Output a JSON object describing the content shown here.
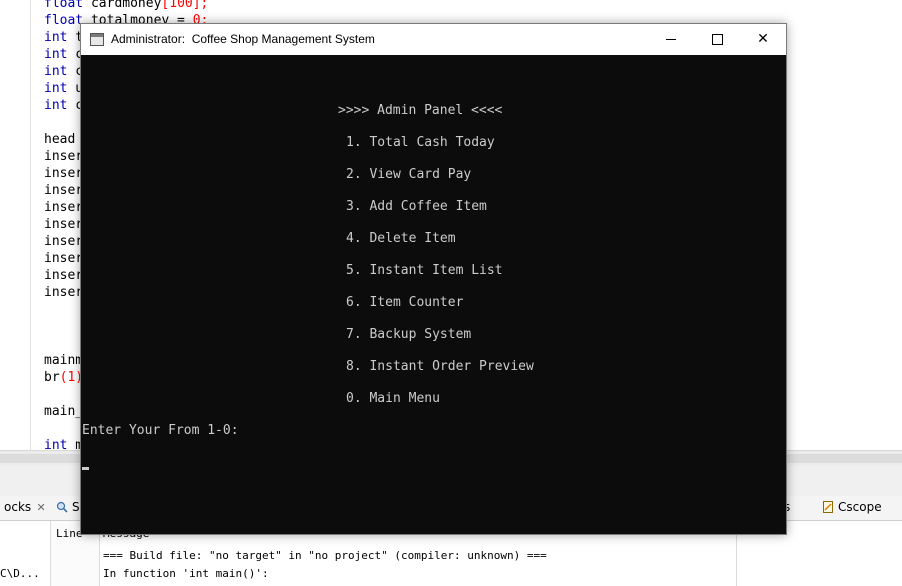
{
  "editor": {
    "lines": [
      {
        "kw": "float",
        "rest": " cardmoney",
        "num": "[100];"
      },
      {
        "kw": "float",
        "rest": " totalmoney = ",
        "num": "0;"
      },
      {
        "kw": "int",
        "rest": " t",
        "num": ""
      },
      {
        "kw": "int",
        "rest": " c",
        "num": ""
      },
      {
        "kw": "int",
        "rest": " c",
        "num": ""
      },
      {
        "kw": "int",
        "rest": " u",
        "num": ""
      },
      {
        "kw": "int",
        "rest": " c",
        "num": ""
      },
      {
        "kw": "",
        "rest": "",
        "num": ""
      },
      {
        "kw": "",
        "rest": "head",
        "num": ""
      },
      {
        "kw": "",
        "rest": "inser",
        "num": ""
      },
      {
        "kw": "",
        "rest": "inser",
        "num": ""
      },
      {
        "kw": "",
        "rest": "inser",
        "num": ""
      },
      {
        "kw": "",
        "rest": "inser",
        "num": ""
      },
      {
        "kw": "",
        "rest": "inser",
        "num": ""
      },
      {
        "kw": "",
        "rest": "inser",
        "num": ""
      },
      {
        "kw": "",
        "rest": "inser",
        "num": ""
      },
      {
        "kw": "",
        "rest": "inser",
        "num": ""
      },
      {
        "kw": "",
        "rest": "inser",
        "num": ""
      },
      {
        "kw": "",
        "rest": "",
        "num": ""
      },
      {
        "kw": "",
        "rest": "",
        "num": ""
      },
      {
        "kw": "",
        "rest": "",
        "num": ""
      },
      {
        "kw": "",
        "rest": "mainm",
        "num": ""
      },
      {
        "kw": "",
        "rest": "br",
        "num": "(1)"
      },
      {
        "kw": "",
        "rest": "",
        "num": ""
      },
      {
        "kw": "",
        "rest": "main_",
        "num": ""
      },
      {
        "kw": "",
        "rest": "",
        "num": ""
      },
      {
        "kw": "int",
        "rest": " m",
        "num": ""
      }
    ]
  },
  "bottom_tabs": {
    "left_tab_label": "ocks",
    "search_tab_label": "Se",
    "right_fragment": "s",
    "cscope_label": "Cscope"
  },
  "log": {
    "header_line": "Line",
    "header_message": "Message",
    "left_path": "C\\D...",
    "rows": [
      "=== Build file: \"no target\" in \"no project\" (compiler: unknown) ===",
      "In function 'int main()':"
    ]
  },
  "window": {
    "title": "Administrator:  Coffee Shop Management System",
    "min_label": "—",
    "close_label": "✕"
  },
  "console": {
    "heading": ">>>> Admin Panel <<<<",
    "menu": [
      "1. Total Cash Today",
      "2. View Card Pay",
      "3. Add Coffee Item",
      "4. Delete Item",
      "5. Instant Item List",
      "6. Item Counter",
      "7. Backup System",
      "8. Instant Order Preview",
      "0. Main Menu"
    ],
    "prompt": "Enter Your From 1-0:"
  }
}
